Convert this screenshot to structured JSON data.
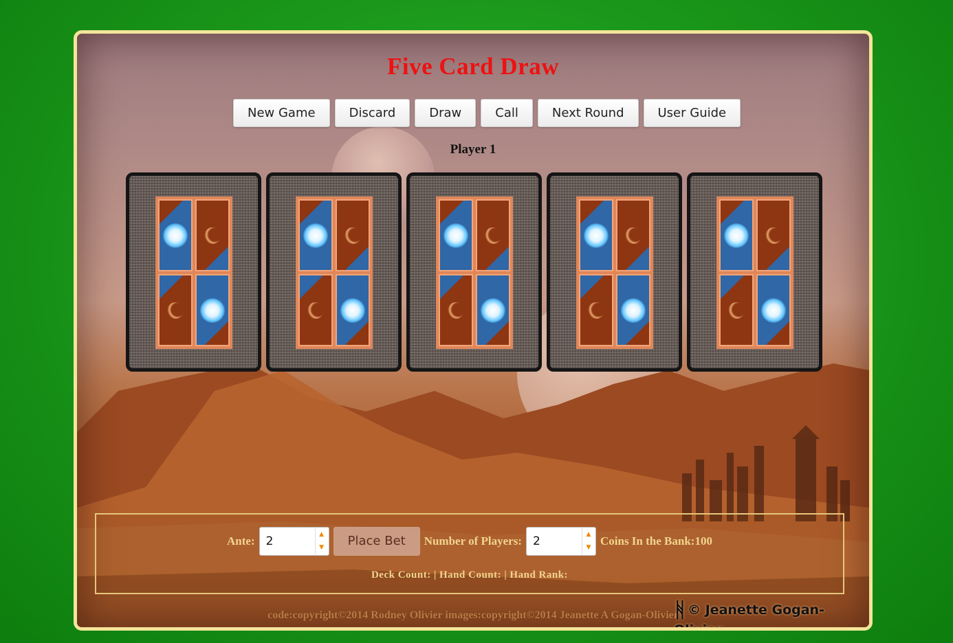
{
  "app": {
    "title": "Five Card Draw"
  },
  "toolbar": {
    "buttons": [
      "New Game",
      "Discard",
      "Draw",
      "Call",
      "Next Round",
      "User Guide"
    ]
  },
  "player": {
    "label": "Player 1"
  },
  "hand": {
    "card_count": 5,
    "face": "back"
  },
  "controls": {
    "ante_label": "Ante:",
    "ante_value": "2",
    "place_bet_label": "Place Bet",
    "players_label": "Number of Players:",
    "players_value": "2",
    "bank_text": "Coins In the Bank:100",
    "deck_count_text": "Deck Count:",
    "hand_count_text": "| Hand Count:",
    "hand_rank_text": "| Hand Rank:"
  },
  "footer": {
    "copyright": "code:copyright©2014 Rodney Olivier images:copyright©2014 Jeanette A Gogan-Olivier",
    "artist_signature": "© Jeanette Gogan-Olivier"
  },
  "colors": {
    "title": "#ee1111",
    "frame_border": "#f3e59a",
    "background_green": "#1c9a1c",
    "control_text": "#f1d58e",
    "spinner_arrow": "#f08a00"
  }
}
